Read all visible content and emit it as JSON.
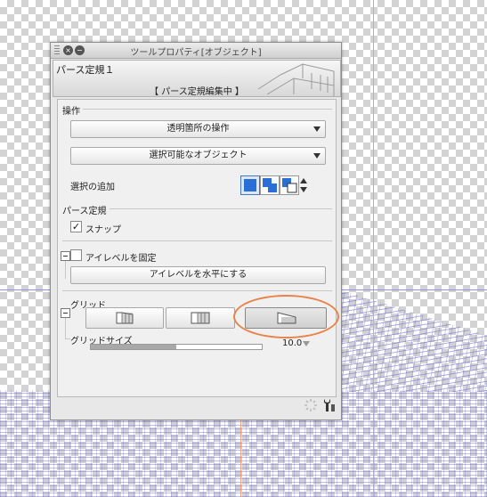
{
  "window": {
    "title": "ツールプロパティ[オブジェクト]",
    "close_icon": "close-icon",
    "minimize_icon": "minimize-icon"
  },
  "header": {
    "name": "パース定規１",
    "status": "【 パース定規編集中 】"
  },
  "sections": {
    "operation": {
      "label": "操作",
      "dropdown1": "透明箇所の操作",
      "dropdown2": "選択可能なオブジェクト",
      "add_selection_label": "選択の追加"
    },
    "perspective": {
      "label": "パース定規",
      "snap_label": "スナップ",
      "snap_checked": true,
      "eye_level_label": "アイレベルを固定",
      "eye_level_checked": false,
      "eye_level_button": "アイレベルを水平にする"
    },
    "grid": {
      "label": "グリッド",
      "size_label": "グリッドサイズ",
      "size_value": "10.0",
      "size_fraction": 0.5
    }
  },
  "colors": {
    "accent": "#e8834a",
    "selected": "#2a6fd6"
  }
}
